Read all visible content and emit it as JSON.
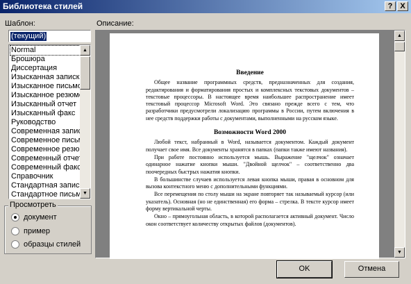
{
  "window": {
    "title": "Библиотека стилей",
    "help_glyph": "?",
    "close_glyph": "X"
  },
  "template": {
    "label": "Шаблон:",
    "current_value": "(текущий)",
    "items": [
      "Normal",
      "Брошюра",
      "Диссертация",
      "Изысканная записка",
      "Изысканное письмо",
      "Изысканное резюме",
      "Изысканный отчет",
      "Изысканный факс",
      "Руководство",
      "Современная записка",
      "Современное письмо",
      "Современное резюме",
      "Современный отчет",
      "Современный факс",
      "Справочник",
      "Стандартная записка",
      "Стандартное письмо"
    ]
  },
  "preview_mode": {
    "label": "Просмотреть",
    "options": [
      {
        "label": "документ",
        "selected": true
      },
      {
        "label": "пример",
        "selected": false
      },
      {
        "label": "образцы стилей",
        "selected": false
      }
    ]
  },
  "description": {
    "label": "Описание:",
    "heading1": "Введение",
    "para1": "Общее название программных средств, предназначенных для создания, редактирования и форматирования простых и комплексных текстовых документов – текстовые процессоры. В настоящее время наибольшее распространение имеет текстовый процессор Microsoft Word. Это связано прежде всего с тем, что разработчики предусмотрели локализацию программы в России, путем включения в нее средств поддержки работы с документами, выполненными на русском языке.",
    "heading2": "Возможности Word 2000",
    "para2": "Любой текст, набранный в Word, называется документом. Каждый документ получает свое имя. Все документы хранятся в папках (папки также имеют названия).",
    "para3": "При работе постоянно используется мышь. Выражение \"щелчок\" означает одинарное нажатие кнопки мыши. \"Двойной щелчок\" – соответственно два поочередных быстрых нажатия кнопки.",
    "para4": "В большинстве случаев используется левая кнопка мыши, правая в основном для вызова контекстного меню с дополнительными функциями.",
    "para5": "Все перемещения по столу мыши на экране повторяет так называемый курсор (или указатель). Основная (но не единственная) его форма – стрелка. В тексте курсор имеет форму вертикальной черты.",
    "para6": "Окно – прямоугольная область, в которой располагается активный документ. Число окон соответствует количеству открытых файлов (документов)."
  },
  "buttons": {
    "ok": "OK",
    "cancel": "Отмена"
  }
}
